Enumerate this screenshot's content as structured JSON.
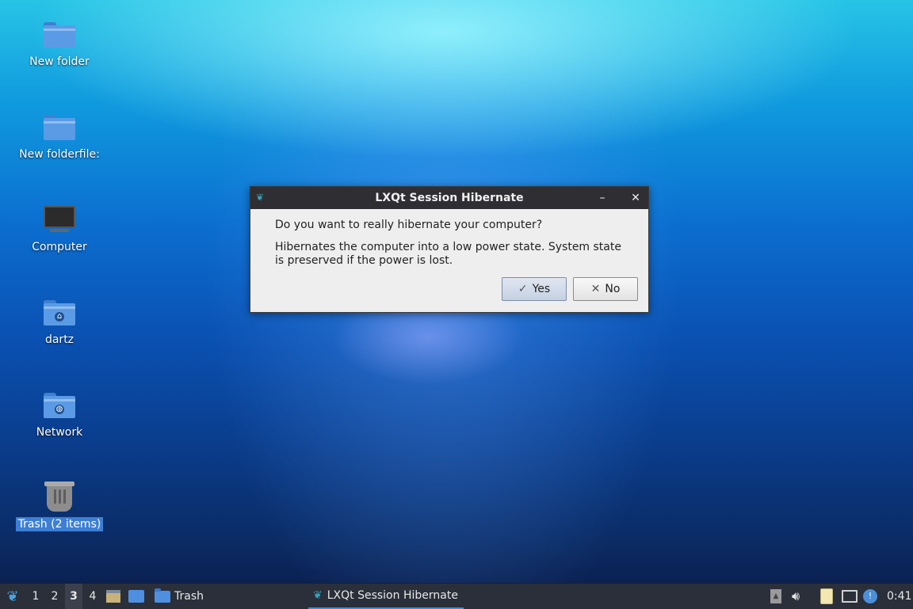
{
  "desktop": {
    "icons": [
      {
        "label": "New folder"
      },
      {
        "label": "New folderfile:"
      },
      {
        "label": "Computer"
      },
      {
        "label": "dartz"
      },
      {
        "label": "Network"
      },
      {
        "label": "Trash (2 items)"
      }
    ]
  },
  "dialog": {
    "title": "LXQt Session Hibernate",
    "question": "Do you want to really hibernate your computer?",
    "description": "Hibernates the computer into a low power state. System state is preserved if the power is lost.",
    "yes_label": "Yes",
    "no_label": "No",
    "minimize_glyph": "–",
    "close_glyph": "✕",
    "yes_glyph": "✓",
    "no_glyph": "✕"
  },
  "taskbar": {
    "workspaces": [
      "1",
      "2",
      "3",
      "4"
    ],
    "active_workspace": "3",
    "trash_task": "Trash",
    "dialog_task": "LXQt Session Hibernate",
    "clock": "0:41"
  },
  "colors": {
    "taskbar_bg": "#2a2f3a",
    "selection": "#3d7fd4",
    "folder": "#5b9be6"
  }
}
